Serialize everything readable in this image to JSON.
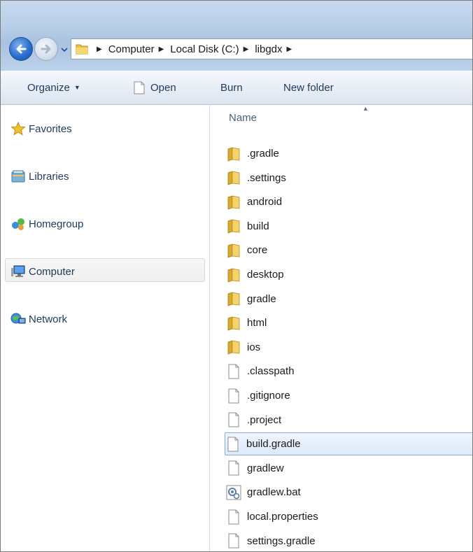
{
  "address_bar": {
    "breadcrumbs": [
      "Computer",
      "Local Disk (C:)",
      "libgdx"
    ]
  },
  "command_bar": {
    "organize_label": "Organize",
    "open_label": "Open",
    "burn_label": "Burn",
    "new_folder_label": "New folder"
  },
  "nav_pane": {
    "items": [
      {
        "label": "Favorites",
        "icon": "star-icon"
      },
      {
        "label": "Libraries",
        "icon": "libraries-icon"
      },
      {
        "label": "Homegroup",
        "icon": "homegroup-icon"
      },
      {
        "label": "Computer",
        "icon": "computer-icon",
        "selected": true
      },
      {
        "label": "Network",
        "icon": "network-icon"
      }
    ]
  },
  "file_list": {
    "column_header": "Name",
    "items": [
      {
        "name": ".gradle",
        "type": "folder"
      },
      {
        "name": ".settings",
        "type": "folder"
      },
      {
        "name": "android",
        "type": "folder"
      },
      {
        "name": "build",
        "type": "folder"
      },
      {
        "name": "core",
        "type": "folder"
      },
      {
        "name": "desktop",
        "type": "folder"
      },
      {
        "name": "gradle",
        "type": "folder"
      },
      {
        "name": "html",
        "type": "folder"
      },
      {
        "name": "ios",
        "type": "folder"
      },
      {
        "name": ".classpath",
        "type": "file"
      },
      {
        "name": ".gitignore",
        "type": "file"
      },
      {
        "name": ".project",
        "type": "file"
      },
      {
        "name": "build.gradle",
        "type": "file",
        "selected": true
      },
      {
        "name": "gradlew",
        "type": "file"
      },
      {
        "name": "gradlew.bat",
        "type": "batch-file"
      },
      {
        "name": "local.properties",
        "type": "file"
      },
      {
        "name": "settings.gradle",
        "type": "file"
      }
    ]
  },
  "colors": {
    "text": "#1e395b",
    "selection_border": "#84acdd",
    "folder_yellow": "#e8c04a"
  }
}
